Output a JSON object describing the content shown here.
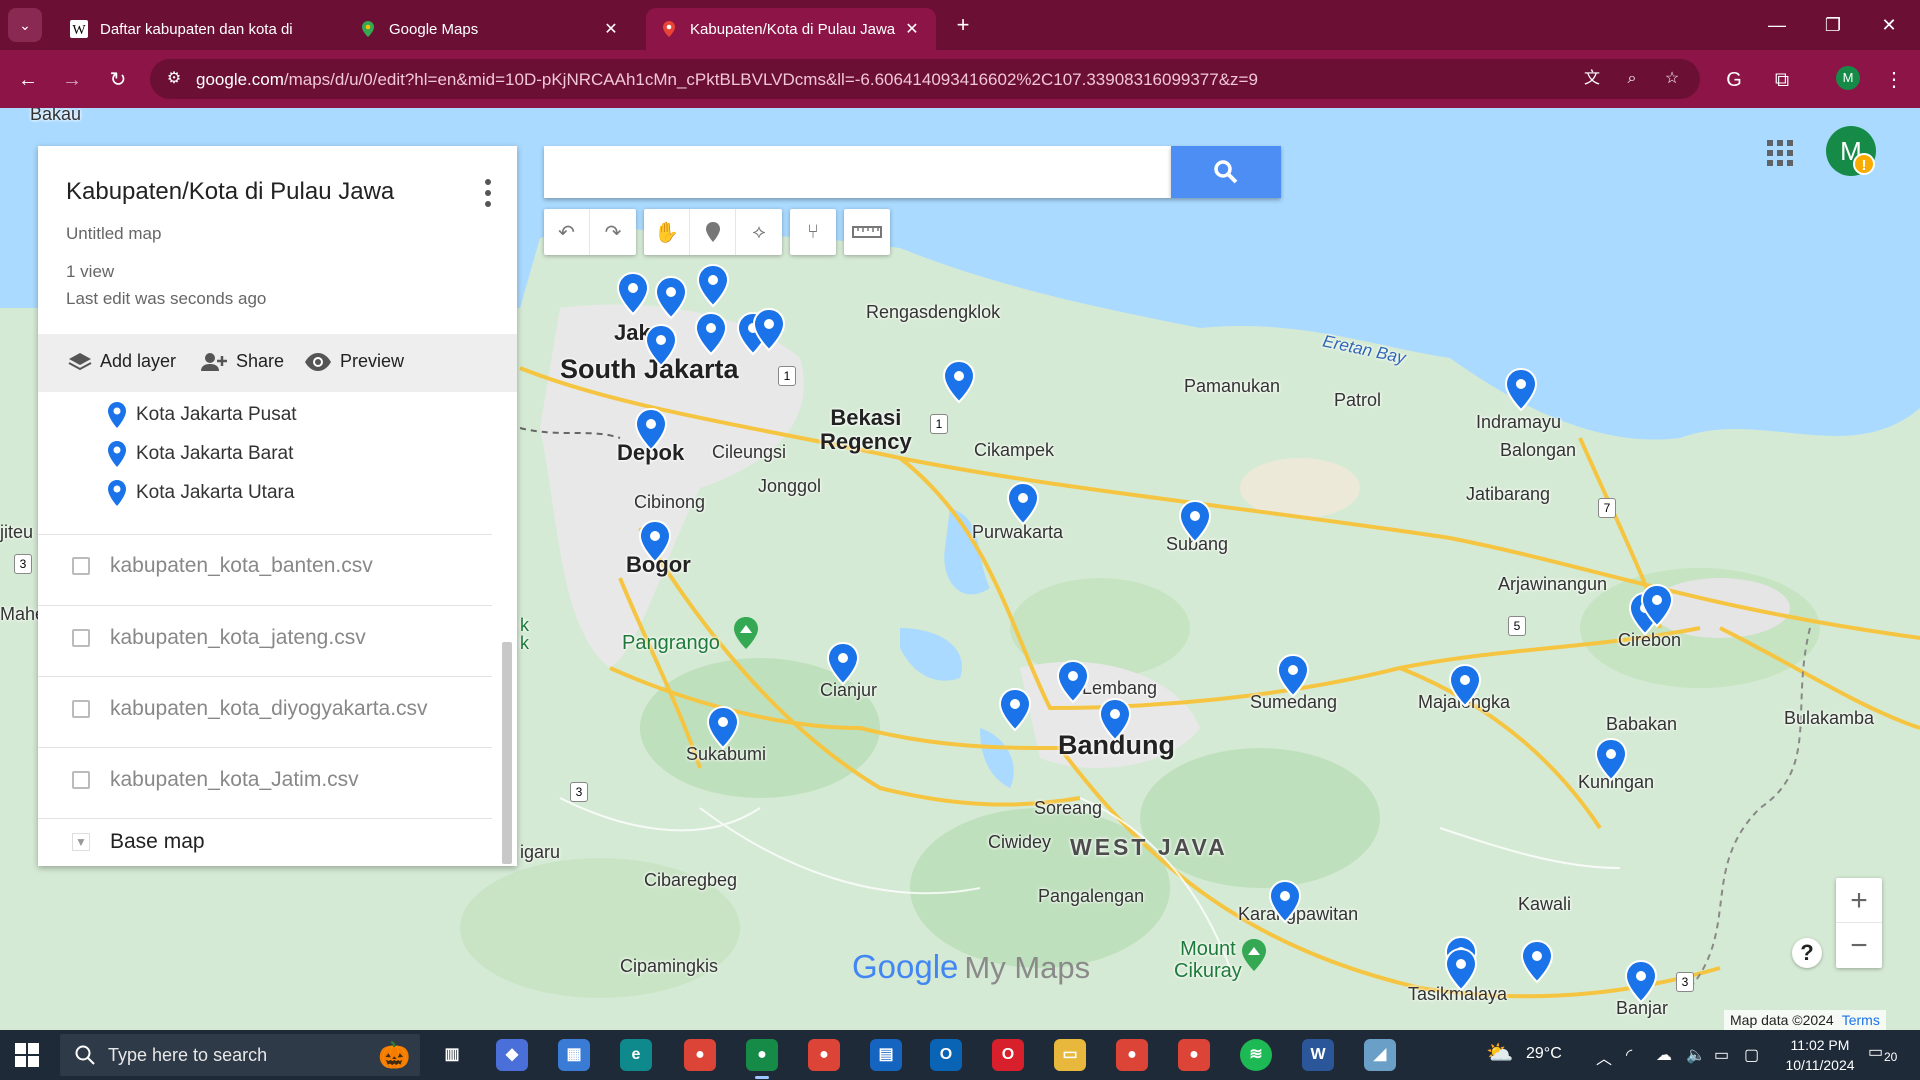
{
  "browser": {
    "tabs": [
      {
        "title": "Daftar kabupaten dan kota di Ja",
        "icon": "wikipedia-icon",
        "active": false
      },
      {
        "title": "Google Maps",
        "icon": "google-maps-icon",
        "active": false
      },
      {
        "title": "Kabupaten/Kota di Pulau Jawa",
        "icon": "my-maps-icon",
        "active": true
      }
    ],
    "url_host": "google.com",
    "url_path": "/maps/d/u/0/edit?hl=en&mid=10D-pKjNRCAAh1cMn_cPktBLBVLVDcms&ll=-6.606414093416602%2C107.33908316099377&z=9",
    "profile_initial": "M",
    "accent_color": "#8c1446"
  },
  "panel": {
    "map_title": "Kabupaten/Kota di Pulau Jawa",
    "description": "Untitled map",
    "views": "1 view",
    "last_edit": "Last edit was seconds ago",
    "actions": {
      "add_layer": "Add layer",
      "share": "Share",
      "preview": "Preview"
    },
    "places": [
      "Kota Jakarta Pusat",
      "Kota Jakarta Barat",
      "Kota Jakarta Utara"
    ],
    "layers": [
      {
        "name": "kabupaten_kota_banten.csv",
        "checked": false
      },
      {
        "name": "kabupaten_kota_jateng.csv",
        "checked": false
      },
      {
        "name": "kabupaten_kota_diyogyakarta.csv",
        "checked": false
      },
      {
        "name": "kabupaten_kota_Jatim.csv",
        "checked": false
      }
    ],
    "base_map": "Base map"
  },
  "map": {
    "search_placeholder": "",
    "labels": {
      "bakau": "Bakau",
      "jakarta": "Jakar",
      "south_jakarta": "South Jakarta",
      "rengasdengklok": "Rengasdengklok",
      "eretan_bay": "Eretan Bay",
      "pamanukan": "Pamanukan",
      "patrol": "Patrol",
      "indramayu": "Indramayu",
      "balongan": "Balongan",
      "bekasi_regency": "Bekasi\nRegency",
      "cikampek": "Cikampek",
      "depok": "Depok",
      "cileungsi": "Cileungsi",
      "jonggol": "Jonggol",
      "cibinong": "Cibinong",
      "purwakarta": "Purwakarta",
      "subang": "Subang",
      "jatibarang": "Jatibarang",
      "bogor": "Bogor",
      "arjawinangun": "Arjawinangun",
      "cirebon": "Cirebon",
      "pangrango": "Pangrango",
      "cianjur": "Cianjur",
      "lembang": "Lembang",
      "sumedang": "Sumedang",
      "majalengka": "Majalengka",
      "bulakamba": "Bulakamba",
      "babakan": "Babakan",
      "sukabumi": "Sukabumi",
      "bandung": "Bandung",
      "kuningan": "Kuningan",
      "soreang": "Soreang",
      "ciwidey": "Ciwidey",
      "west_java": "WEST JAVA",
      "cibaregbeg": "Cibaregbeg",
      "pangalengan": "Pangalengan",
      "karangpawitan": "Karangpawitan",
      "kawali": "Kawali",
      "mount_cikuray": "Mount\nCikuray",
      "cipamingkis": "Cipamingkis",
      "tasikmalaya": "Tasikmalaya",
      "banjar": "Banjar",
      "jiteu": "jiteu",
      "mahe": "Mahe",
      "k": "k\nk",
      "igaru": "igaru"
    },
    "route_shields": [
      "1",
      "1",
      "3",
      "5",
      "7",
      "3",
      "3"
    ],
    "map_data": "Map data ©2024",
    "terms": "Terms",
    "watermark_google": "Google",
    "watermark_mymaps": "My Maps",
    "marker_color": "#1a73e8",
    "zoom_in": "+",
    "zoom_out": "−",
    "help": "?"
  },
  "taskbar": {
    "search_placeholder": "Type here to search",
    "weather": "29°C",
    "time": "11:02 PM",
    "date": "10/11/2024",
    "notification_count": "20"
  }
}
